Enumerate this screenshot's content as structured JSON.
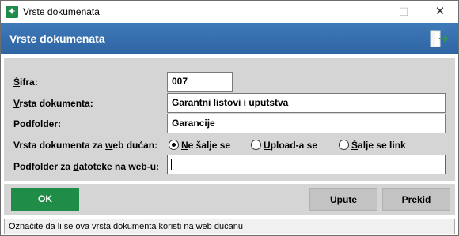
{
  "window": {
    "title": "Vrste dokumenata",
    "min_glyph": "—",
    "max_glyph": "☐",
    "close_glyph": "✕"
  },
  "header": {
    "title": "Vrste dokumenata",
    "exit_icon": "exit-door-arrow-icon"
  },
  "form": {
    "sifra_label_key": "Š",
    "sifra_label_rest": "ifra:",
    "sifra_value": "007",
    "vrsta_label_key": "V",
    "vrsta_label_rest": "rsta dokumenta:",
    "vrsta_value": "Garantni listovi i uputstva",
    "podfolder_label": "Podfolder:",
    "podfolder_value": "Garancije",
    "web_label_pre": "Vrsta dokumenta za ",
    "web_label_key": "w",
    "web_label_post": "eb dućan:",
    "web_options": [
      {
        "key": "N",
        "rest": "e šalje se",
        "checked": true
      },
      {
        "key": "U",
        "rest": "pload-a se",
        "checked": false
      },
      {
        "key": "Š",
        "rest": "alje se link",
        "checked": false
      }
    ],
    "webfolder_label_pre": "Podfolder za ",
    "webfolder_label_key": "d",
    "webfolder_label_post": "atoteke na web-u:",
    "webfolder_value": ""
  },
  "buttons": {
    "ok": "OK",
    "upute": "Upute",
    "prekid": "Prekid"
  },
  "status": {
    "text": "Označite da li se ova vrsta dokumenta koristi na web dućanu"
  },
  "colors": {
    "header_blue": "#3672b1",
    "ok_green": "#1f8c48",
    "panel_gray": "#d5d5d5"
  }
}
